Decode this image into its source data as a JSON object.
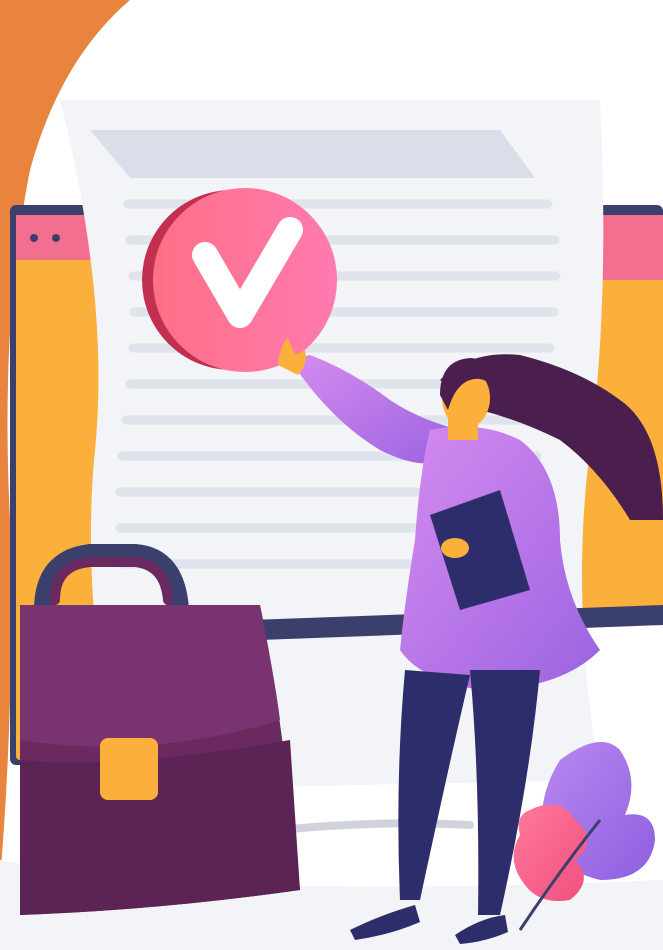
{
  "illustration": {
    "subject": "approved-document-with-woman-and-briefcase",
    "icons": {
      "approval": "check-mark-icon"
    },
    "colors": {
      "background": "#ffffff",
      "accent_orange": "#e8843e",
      "monitor_frame": "#3b3f6b",
      "monitor_screen": "#fbb03b",
      "monitor_bar": "#f36f8f",
      "document_paper": "#f2f4f8",
      "document_header": "#d9dee8",
      "document_line": "#dfe3ec",
      "badge_light": "#ff7a9a",
      "badge_dark": "#c2304f",
      "briefcase": "#6a2a60",
      "briefcase_latch": "#fbb03b",
      "sweater": "#b278e6",
      "hair": "#4a1f4d",
      "skin": "#fbb03b",
      "pants": "#2e2d6b",
      "plant_pink": "#f36f8f",
      "plant_purple": "#a77be0"
    }
  }
}
